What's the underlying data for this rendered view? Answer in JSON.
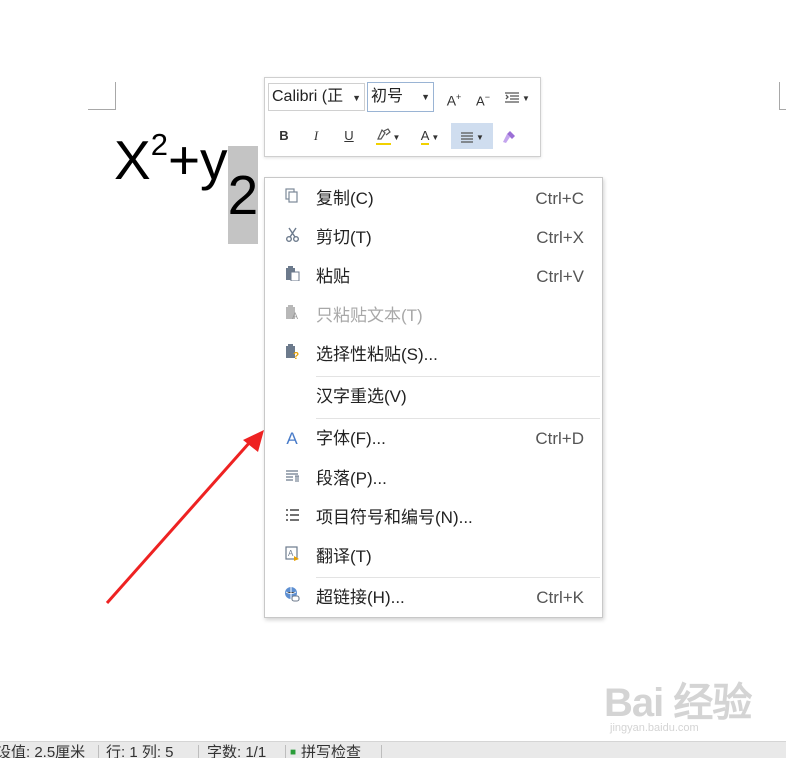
{
  "document": {
    "base": "X",
    "superscript": "2",
    "rest": "+y",
    "selected": "2"
  },
  "toolbar": {
    "font_name": "Calibri (正",
    "font_size": "初号",
    "grow_font": "A",
    "shrink_font": "A",
    "bold": "B",
    "italic": "I",
    "underline": "U",
    "font_color": "A"
  },
  "context_menu": {
    "items": [
      {
        "icon": "copy-icon",
        "label": "复制(C)",
        "shortcut": "Ctrl+C",
        "enabled": true
      },
      {
        "icon": "scissors-icon",
        "label": "剪切(T)",
        "shortcut": "Ctrl+X",
        "enabled": true
      },
      {
        "icon": "paste-icon",
        "label": "粘贴",
        "shortcut": "Ctrl+V",
        "enabled": true
      },
      {
        "icon": "paste-text-icon",
        "label": "只粘贴文本(T)",
        "shortcut": "",
        "enabled": false
      },
      {
        "icon": "paste-special-icon",
        "label": "选择性粘贴(S)...",
        "shortcut": "",
        "enabled": true
      },
      {
        "icon": "",
        "label": "汉字重选(V)",
        "shortcut": "",
        "enabled": true
      },
      {
        "icon": "font-icon",
        "label": "字体(F)...",
        "shortcut": "Ctrl+D",
        "enabled": true
      },
      {
        "icon": "paragraph-icon",
        "label": "段落(P)...",
        "shortcut": "",
        "enabled": true
      },
      {
        "icon": "list-icon",
        "label": "项目符号和编号(N)...",
        "shortcut": "",
        "enabled": true
      },
      {
        "icon": "translate-icon",
        "label": "翻译(T)",
        "shortcut": "",
        "enabled": true
      },
      {
        "icon": "hyperlink-icon",
        "label": "超链接(H)...",
        "shortcut": "Ctrl+K",
        "enabled": true
      }
    ]
  },
  "statusbar": {
    "position": "设值: 2.5厘米",
    "line_col": "行: 1  列: 5",
    "word_count": "字数: 1/1",
    "spell_check": "拼写检查"
  },
  "watermark": {
    "logo": "Bai 经验",
    "url": "jingyan.baidu.com"
  },
  "colors": {
    "annotation_arrow": "#ee2222",
    "selection": "#c4c4c4",
    "toolbar_active": "#cfddef"
  }
}
